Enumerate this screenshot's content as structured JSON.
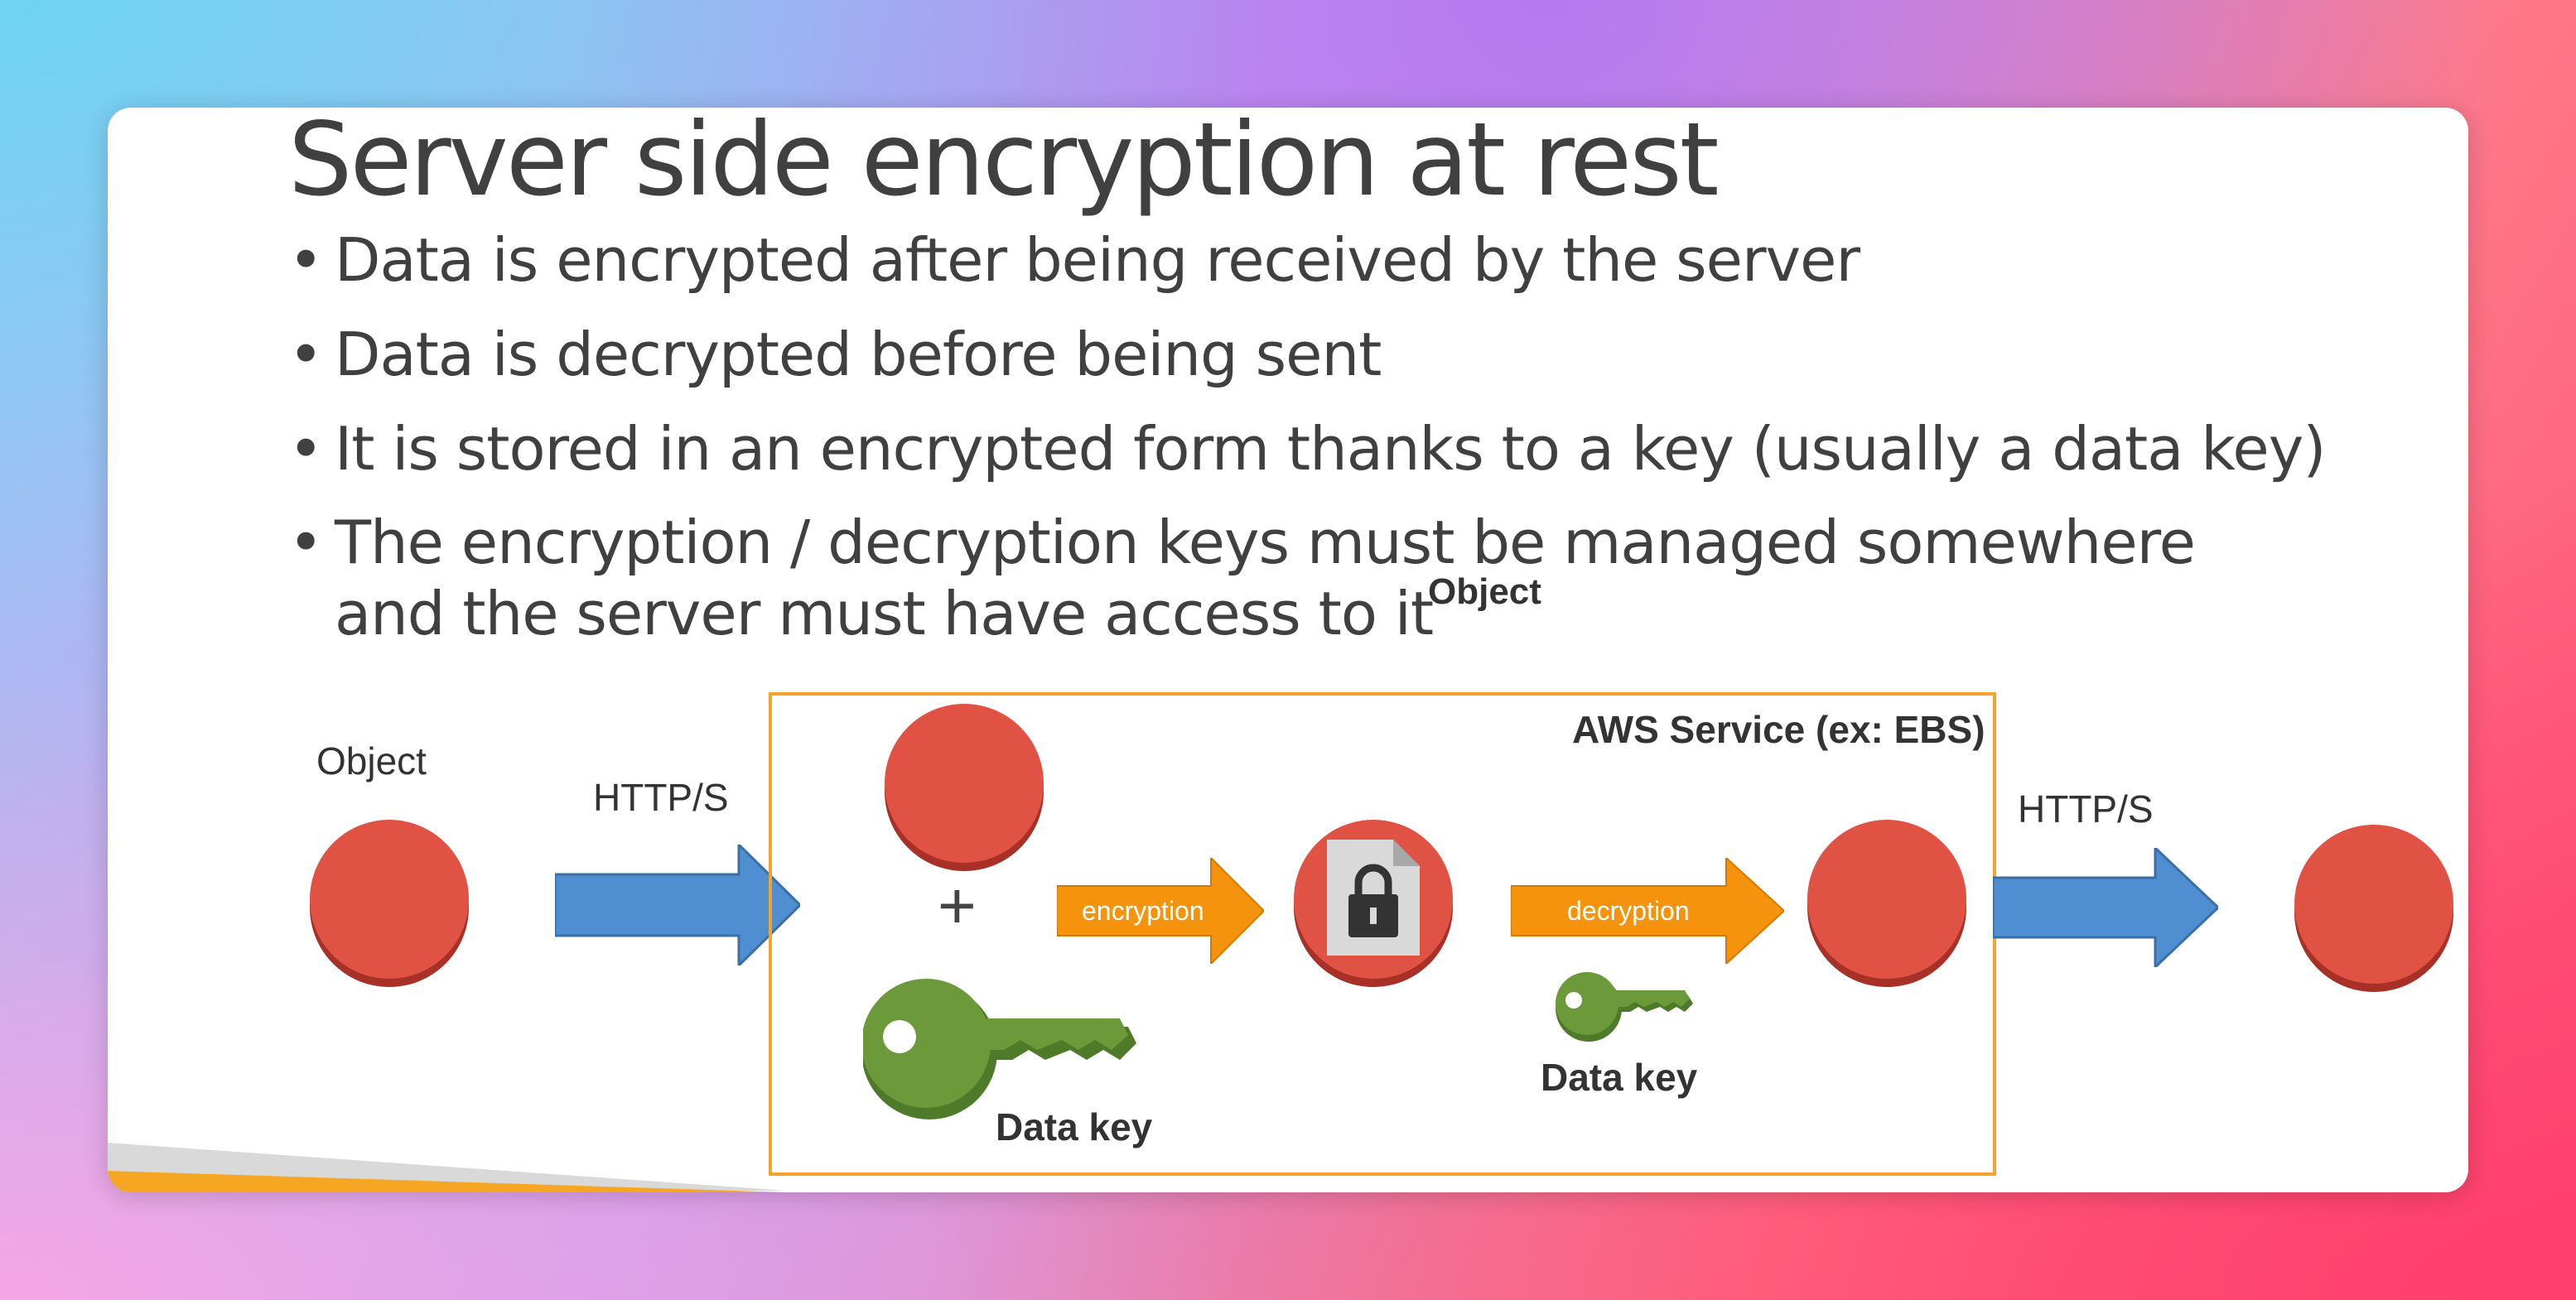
{
  "slide": {
    "title": "Server side encryption at rest",
    "bullets": [
      "Data is encrypted after being received by the server",
      "Data is decrypted before being sent",
      "It is stored in an encrypted form thanks to a key (usually a data key)",
      "The encryption / decryption keys must be managed somewhere and the server must have access to it"
    ]
  },
  "diagram": {
    "object_left_label": "Object",
    "object_top_label": "Object",
    "http_in_label": "HTTP/S",
    "http_out_label": "HTTP/S",
    "service_label": "AWS Service (ex: EBS)",
    "encryption_label": "encryption",
    "decryption_label": "decryption",
    "data_key_large_label": "Data key",
    "data_key_small_label": "Data key",
    "plus_symbol": "+",
    "colors": {
      "object_red": "#e05244",
      "http_arrow_blue": "#4f8ed1",
      "process_arrow_orange": "#f5940c",
      "key_green": "#6c9a3a",
      "service_border": "#f5a32a"
    }
  }
}
